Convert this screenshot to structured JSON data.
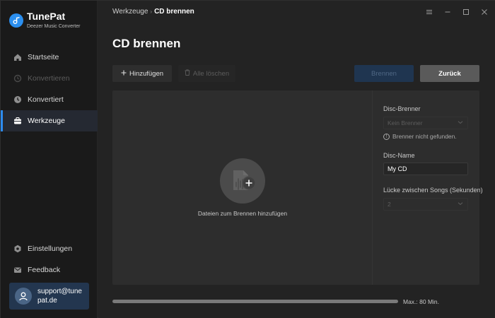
{
  "app": {
    "name": "TunePat",
    "subtitle": "Deezer Music Converter",
    "accent_color": "#2d8cf0"
  },
  "sidebar": {
    "items": [
      {
        "label": "Startseite",
        "icon": "home-icon",
        "state": "normal"
      },
      {
        "label": "Konvertieren",
        "icon": "convert-icon",
        "state": "disabled"
      },
      {
        "label": "Konvertiert",
        "icon": "clock-icon",
        "state": "normal"
      },
      {
        "label": "Werkzeuge",
        "icon": "toolbox-icon",
        "state": "active"
      }
    ],
    "bottom_items": [
      {
        "label": "Einstellungen",
        "icon": "gear-icon"
      },
      {
        "label": "Feedback",
        "icon": "mail-icon"
      }
    ],
    "account": {
      "email": "support@tunepat.de",
      "icon": "user-icon"
    }
  },
  "header": {
    "breadcrumb": [
      "Werkzeuge",
      "CD brennen"
    ],
    "window_controls": [
      "menu-icon",
      "minimize-icon",
      "maximize-icon",
      "close-icon"
    ]
  },
  "page": {
    "title": "CD brennen"
  },
  "toolbar": {
    "add_label": "Hinzufügen",
    "clear_label": "Alle löschen",
    "burn_label": "Brennen",
    "back_label": "Zurück"
  },
  "drop_zone": {
    "text": "Dateien zum Brennen hinzufügen",
    "icon": "add-music-file-icon"
  },
  "settings": {
    "burner_label": "Disc-Brenner",
    "burner_value": "Kein Brenner",
    "burner_info": "Brenner nicht gefunden.",
    "name_label": "Disc-Name",
    "name_value": "My CD",
    "gap_label": "Lücke zwischen Songs (Sekunden)",
    "gap_value": "2"
  },
  "capacity": {
    "label": "Max.: 80 Min.",
    "used_fraction": 0
  }
}
